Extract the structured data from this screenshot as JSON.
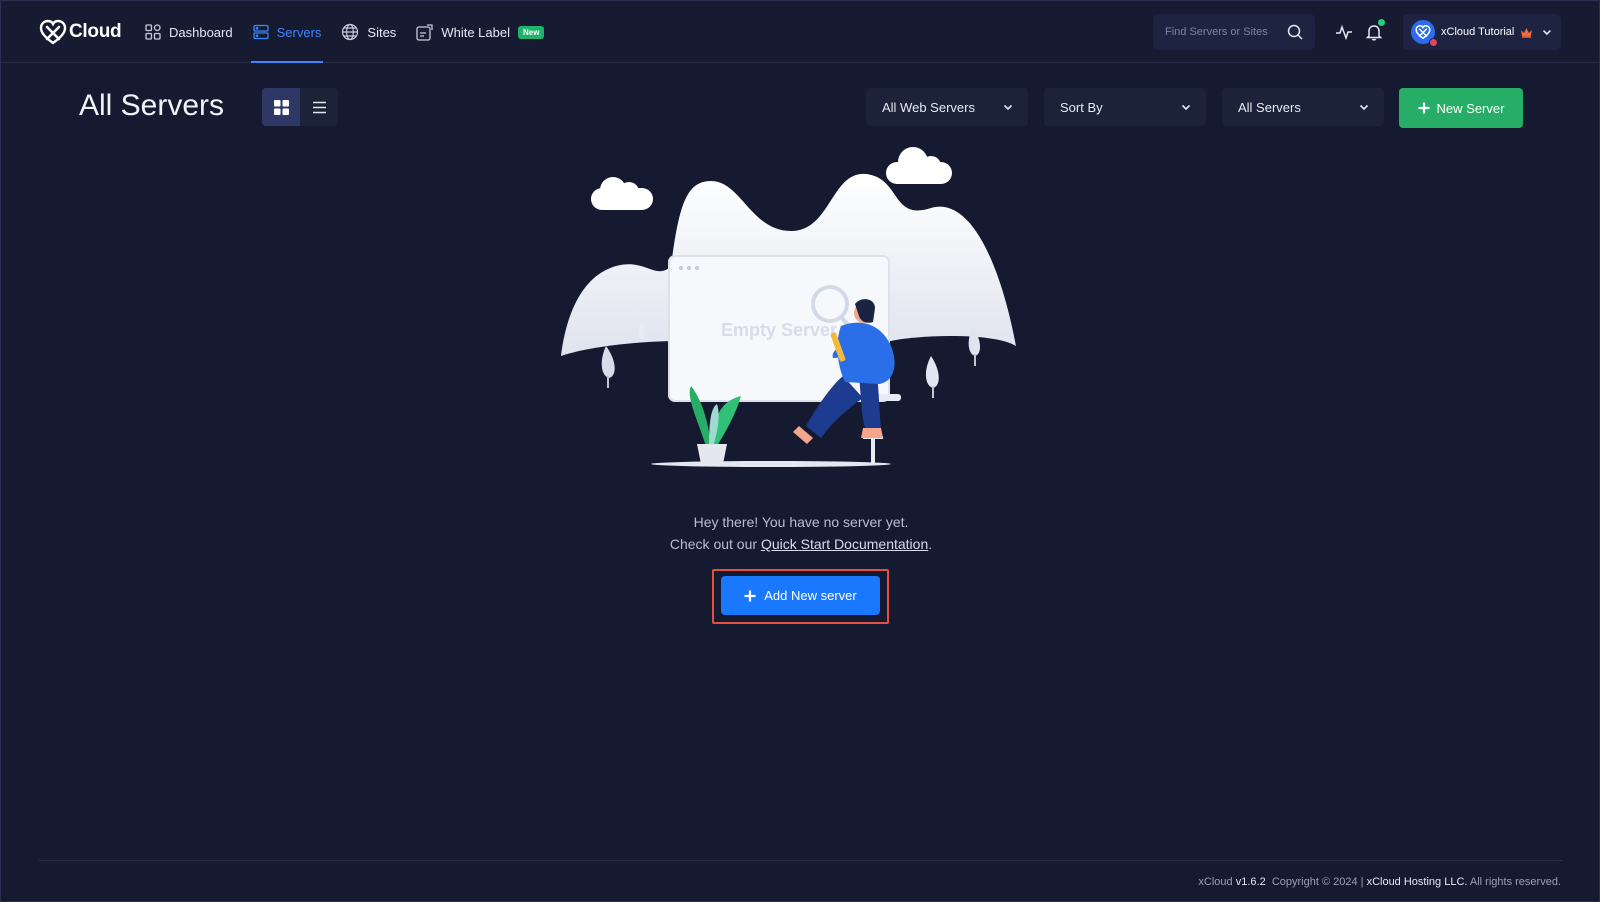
{
  "app": {
    "logo_text": "Cloud"
  },
  "nav": {
    "items": [
      {
        "label": "Dashboard",
        "icon": "dashboard-icon"
      },
      {
        "label": "Servers",
        "icon": "servers-icon",
        "active": true
      },
      {
        "label": "Sites",
        "icon": "globe-icon"
      },
      {
        "label": "White Label",
        "icon": "white-label-icon",
        "badge": "New"
      }
    ]
  },
  "search": {
    "placeholder": "Find Servers or Sites"
  },
  "account": {
    "name": "xCloud Tutorial"
  },
  "page": {
    "title": "All Servers"
  },
  "filters": {
    "web_servers": "All Web Servers",
    "sort_by": "Sort By",
    "servers": "All Servers"
  },
  "actions": {
    "new_server": "New Server",
    "add_new_server": "Add New server"
  },
  "empty_state": {
    "illustration_text": "Empty Server",
    "line1": "Hey there! You have no server yet.",
    "line2_prefix": "Check out our ",
    "link": "Quick Start Documentation",
    "line2_suffix": "."
  },
  "footer": {
    "brand": "xCloud",
    "version": "v1.6.2",
    "copyright": "Copyright © 2024 |",
    "company": "xCloud Hosting LLC.",
    "rights": "All rights reserved."
  },
  "colors": {
    "accent": "#1a78ff",
    "success": "#27ae66",
    "highlight": "#e2503f",
    "background": "#151a30"
  }
}
